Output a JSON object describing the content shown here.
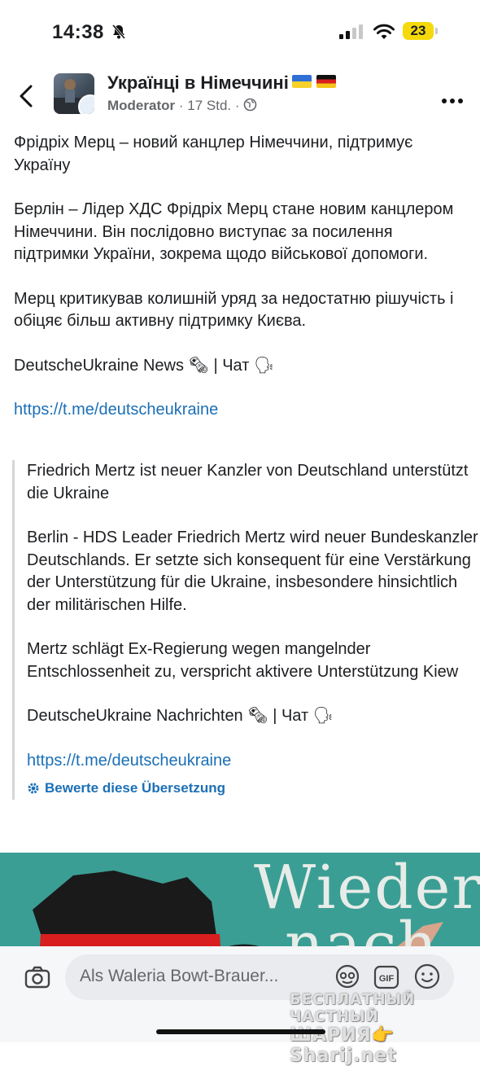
{
  "status_bar": {
    "time": "14:38",
    "battery": "23"
  },
  "header": {
    "group_name": "Українці в Німеччині",
    "role": "Moderator",
    "time_ago": "17 Std."
  },
  "post": {
    "ua_title": "Фрідріх Мерц – новий канцлер Німеччини, підтримує Україну",
    "ua_body1": "Берлін – Лідер ХДС Фрідріх Мерц стане новим канцлером Німеччини. Він послідовно виступає за посилення підтримки України, зокрема щодо військової допомоги.",
    "ua_body2": "Мерц критикував колишній уряд за недостатню рішучість і обіцяє більш активну підтримку Києва.",
    "ua_sig": "DeutscheUkraine News 🗞 | Чат 🗣",
    "link": "https://t.me/deutscheukraine"
  },
  "translation": {
    "title": "Friedrich Mertz ist neuer Kanzler von Deutschland unterstützt die Ukraine",
    "body1": "Berlin - HDS Leader Friedrich Mertz wird neuer Bundeskanzler Deutschlands. Er setzte sich konsequent für eine Verstärkung der Unterstützung für die Ukraine, insbesondere hinsichtlich der militärischen Hilfe.",
    "body2": "Mertz schlägt Ex-Regierung wegen mangelnder Entschlossenheit zu, verspricht aktivere Unterstützung Kiew",
    "sig": "DeutscheUkraine Nachrichten 🗞 | Чат 🗣",
    "link": "https://t.me/deutscheukraine",
    "rate_label": "Bewerte diese Übersetzung"
  },
  "image": {
    "line1": "Wieder",
    "line2": "nach"
  },
  "comment": {
    "placeholder": "Als Waleria Bowt-Brauer..."
  },
  "watermark": {
    "line1": "БЕСПЛАТНЫЙ ЧАСТНЫЙ",
    "line2": "ШАРИЯ👉Sharij.net"
  },
  "colors": {
    "link": "#1b6fb6",
    "battery": "#f5d90a",
    "image_bg": "#3b9e94"
  }
}
